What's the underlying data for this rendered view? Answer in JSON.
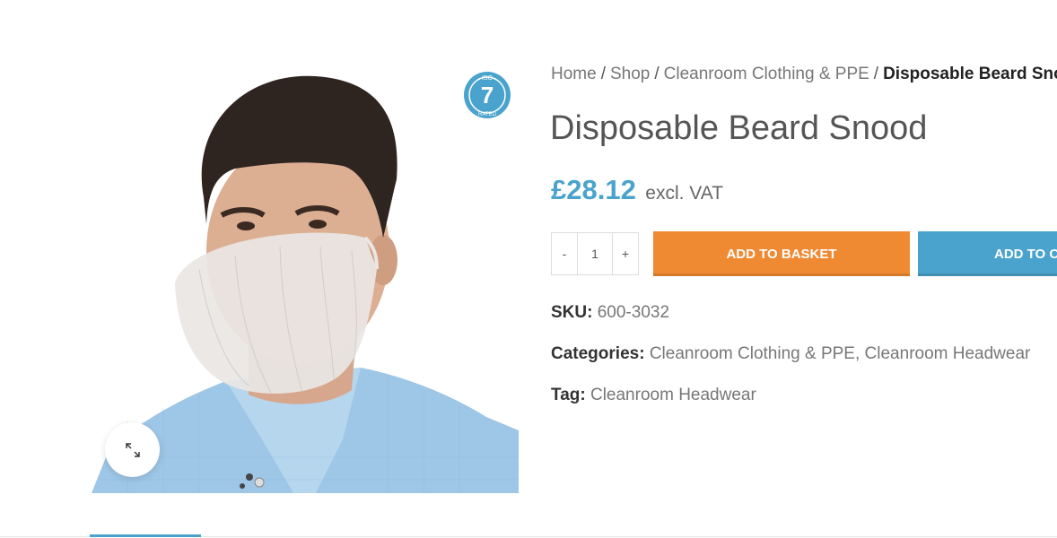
{
  "gallery": {
    "image_alt": "Man wearing a white disposable beard snood",
    "zoom_icon": "expand-icon"
  },
  "badge": {
    "top_text": "ISO",
    "number": "7",
    "bottom_text": "RATED",
    "color": "#4aa3cc"
  },
  "breadcrumb": {
    "items": [
      "Home",
      "Shop",
      "Cleanroom Clothing & PPE"
    ],
    "separator": "/",
    "current": "Disposable Beard Snood"
  },
  "product": {
    "title": "Disposable Beard Snood",
    "price": "£28.12",
    "price_suffix": "excl. VAT",
    "price_color": "#4aa3cc"
  },
  "quantity": {
    "minus": "-",
    "value": "1",
    "plus": "+"
  },
  "buttons": {
    "add_to_basket": "ADD TO BASKET",
    "add_to_other": "ADD TO C",
    "basket_color": "#ef8a32",
    "other_color": "#4aa3cc"
  },
  "meta": {
    "sku_label": "SKU:",
    "sku_value": "600-3032",
    "categories_label": "Categories:",
    "categories": [
      "Cleanroom Clothing & PPE",
      "Cleanroom Headwear"
    ],
    "tag_label": "Tag:",
    "tag_value": "Cleanroom Headwear"
  }
}
